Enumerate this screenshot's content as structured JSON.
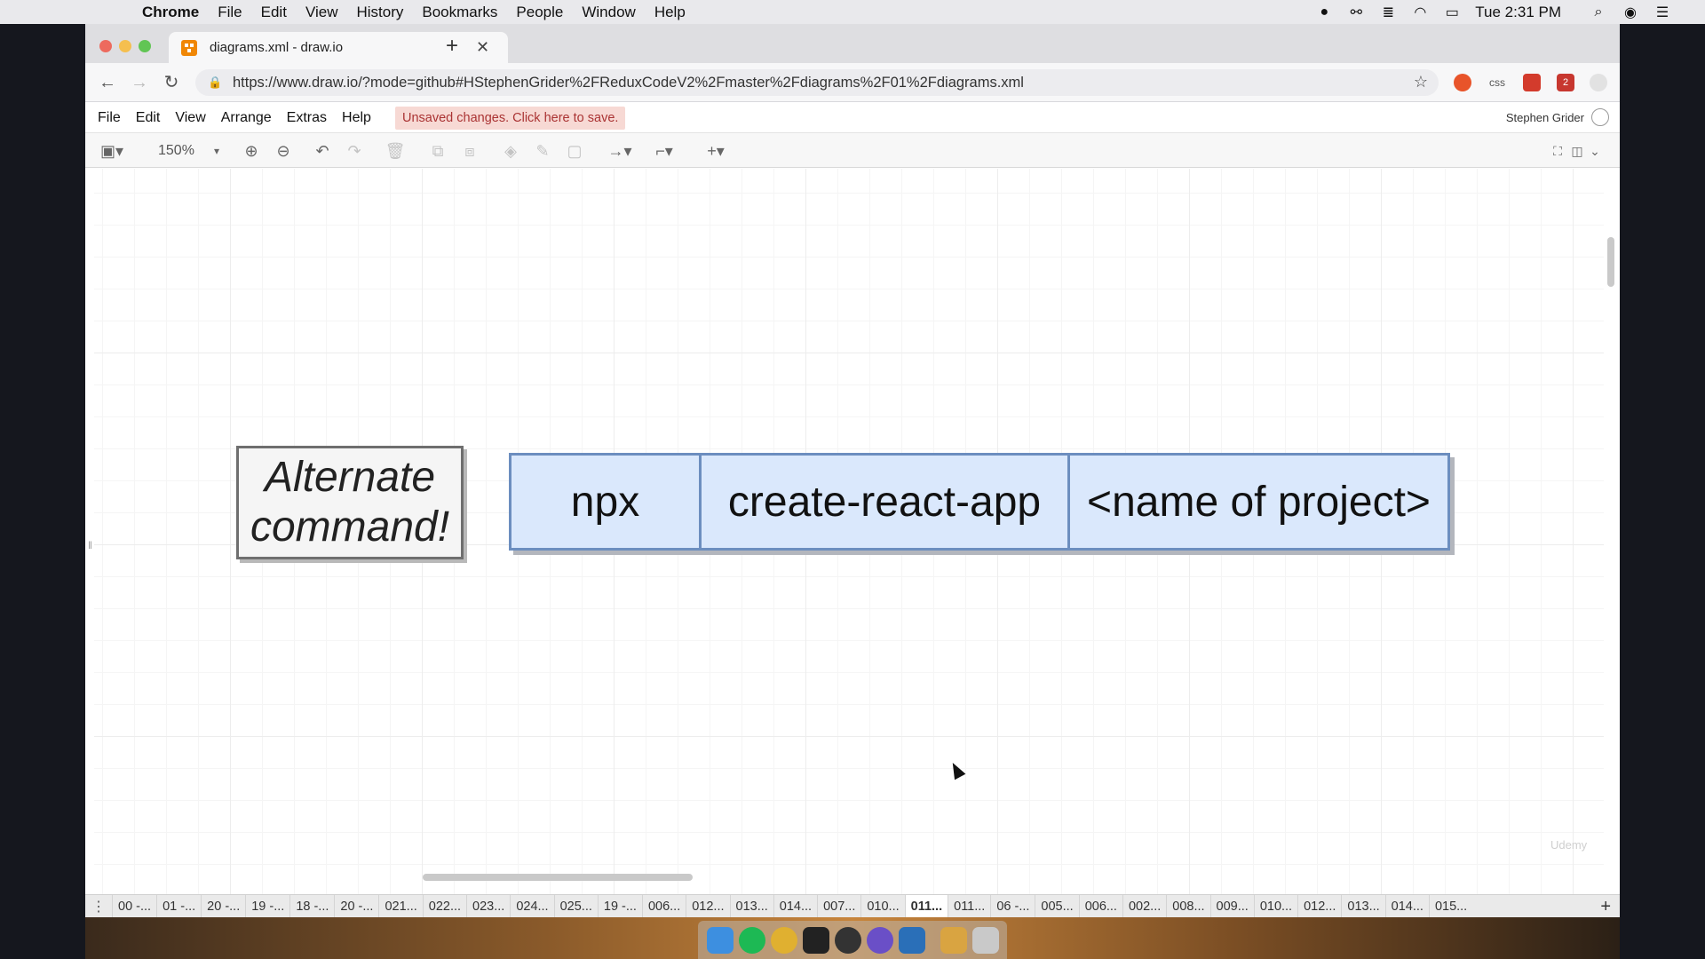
{
  "menubar": {
    "app_name": "Chrome",
    "items": [
      "File",
      "Edit",
      "View",
      "History",
      "Bookmarks",
      "People",
      "Window",
      "Help"
    ],
    "clock": "Tue 2:31 PM"
  },
  "browser": {
    "tab_title": "diagrams.xml - draw.io",
    "url": "https://www.draw.io/?mode=github#HStephenGrider%2FReduxCodeV2%2Fmaster%2Fdiagrams%2F01%2Fdiagrams.xml",
    "extension_css_label": "css",
    "extension_badge": "2"
  },
  "drawio": {
    "menu": [
      "File",
      "Edit",
      "View",
      "Arrange",
      "Extras",
      "Help"
    ],
    "save_notice": "Unsaved changes. Click here to save.",
    "user_name": "Stephen Grider",
    "zoom": "150%"
  },
  "diagram": {
    "alt_line1": "Alternate",
    "alt_line2": "command!",
    "cells": [
      "npx",
      "create-react-app",
      "<name of project>"
    ],
    "colors": {
      "cell_fill": "#dae8fc",
      "cell_border": "#6c8ebf",
      "note_fill": "#f5f5f5"
    }
  },
  "watermark": "Udemy",
  "page_tabs": {
    "labels": [
      "00 -...",
      "01 -...",
      "20 -...",
      "19 -...",
      "18 -...",
      "20 -...",
      "021...",
      "022...",
      "023...",
      "024...",
      "025...",
      "19 -...",
      "006...",
      "012...",
      "013...",
      "014...",
      "007...",
      "010...",
      "011...",
      "011...",
      "06 -...",
      "005...",
      "006...",
      "002...",
      "008...",
      "009...",
      "010...",
      "012...",
      "013...",
      "014...",
      "015..."
    ],
    "active_index": 18
  }
}
